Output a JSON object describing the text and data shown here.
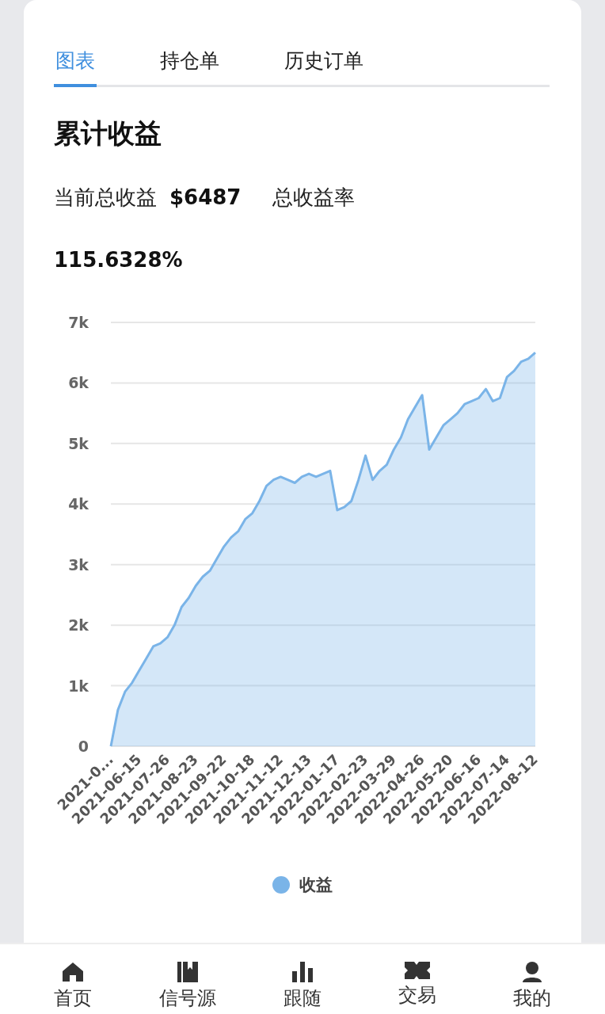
{
  "tabs": [
    {
      "label": "图表",
      "selected": true
    },
    {
      "label": "持仓单",
      "selected": false
    },
    {
      "label": "历史订单",
      "selected": false
    }
  ],
  "section_title": "累计收益",
  "summary": {
    "total_label": "当前总收益",
    "total_value": "$6487",
    "rate_label": "总收益率",
    "rate_value": "115.6328%"
  },
  "chart_data": {
    "type": "area",
    "grid": true,
    "ylim": [
      0,
      7000
    ],
    "categories": [
      "2021-0...",
      null,
      null,
      null,
      "2021-06-15",
      null,
      null,
      null,
      "2021-07-26",
      null,
      null,
      null,
      "2021-08-23",
      null,
      null,
      null,
      "2021-09-22",
      null,
      null,
      null,
      "2021-10-18",
      null,
      null,
      null,
      "2021-11-12",
      null,
      null,
      null,
      "2021-12-13",
      null,
      null,
      null,
      "2022-01-17",
      null,
      null,
      null,
      "2022-02-23",
      null,
      null,
      null,
      "2022-03-29",
      null,
      null,
      null,
      "2022-04-26",
      null,
      null,
      null,
      "2022-05-20",
      null,
      null,
      null,
      "2022-06-16",
      null,
      null,
      null,
      "2022-07-14",
      null,
      null,
      null,
      "2022-08-12"
    ],
    "series": [
      {
        "name": "收益",
        "color": "#7ab4e8",
        "values": [
          0,
          600,
          900,
          1050,
          1250,
          1450,
          1650,
          1700,
          1800,
          2000,
          2300,
          2450,
          2650,
          2800,
          2900,
          3100,
          3300,
          3450,
          3550,
          3750,
          3850,
          4050,
          4300,
          4400,
          4450,
          4400,
          4350,
          4450,
          4500,
          4450,
          4500,
          4550,
          3900,
          3950,
          4050,
          4400,
          4800,
          4400,
          4550,
          4650,
          4900,
          5100,
          5400,
          5600,
          5800,
          4900,
          5100,
          5300,
          5400,
          5500,
          5650,
          5700,
          5750,
          5900,
          5700,
          5750,
          6100,
          6200,
          6350,
          6400,
          6500
        ]
      }
    ],
    "yticks": [
      {
        "value": 0,
        "label": "0"
      },
      {
        "value": 1000,
        "label": "1k"
      },
      {
        "value": 2000,
        "label": "2k"
      },
      {
        "value": 3000,
        "label": "3k"
      },
      {
        "value": 4000,
        "label": "4k"
      },
      {
        "value": 5000,
        "label": "5k"
      },
      {
        "value": 6000,
        "label": "6k"
      },
      {
        "value": 7000,
        "label": "7k"
      }
    ]
  },
  "bottom_nav": [
    {
      "label": "首页"
    },
    {
      "label": "信号源"
    },
    {
      "label": "跟随"
    },
    {
      "label": "交易"
    },
    {
      "label": "我的"
    }
  ]
}
